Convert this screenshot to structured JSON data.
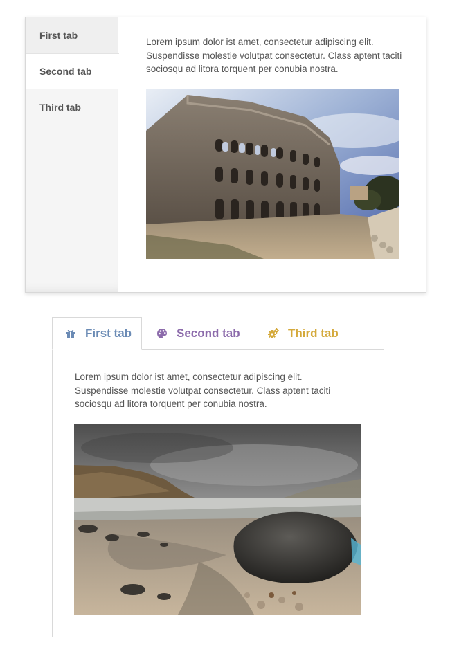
{
  "vertical_tabs": {
    "tabs": [
      {
        "label": "First tab"
      },
      {
        "label": "Second tab"
      },
      {
        "label": "Third tab"
      }
    ],
    "active_index": 1,
    "body_text": "Lorem ipsum dolor ist amet, consectetur adipiscing elit. Suspendisse molestie volutpat consectetur. Class aptent taciti sociosqu ad litora torquent per conubia nostra."
  },
  "horizontal_tabs": {
    "tabs": [
      {
        "label": "First tab",
        "icon": "gift-icon",
        "color": "#6b8bb5"
      },
      {
        "label": "Second tab",
        "icon": "palette-icon",
        "color": "#8c6bab"
      },
      {
        "label": "Third tab",
        "icon": "gears-icon",
        "color": "#d4a93b"
      }
    ],
    "active_index": 0,
    "body_text": "Lorem ipsum dolor ist amet, consectetur adipiscing elit. Suspendisse molestie volutpat consectetur. Class aptent taciti sociosqu ad litora torquent per conubia nostra."
  }
}
